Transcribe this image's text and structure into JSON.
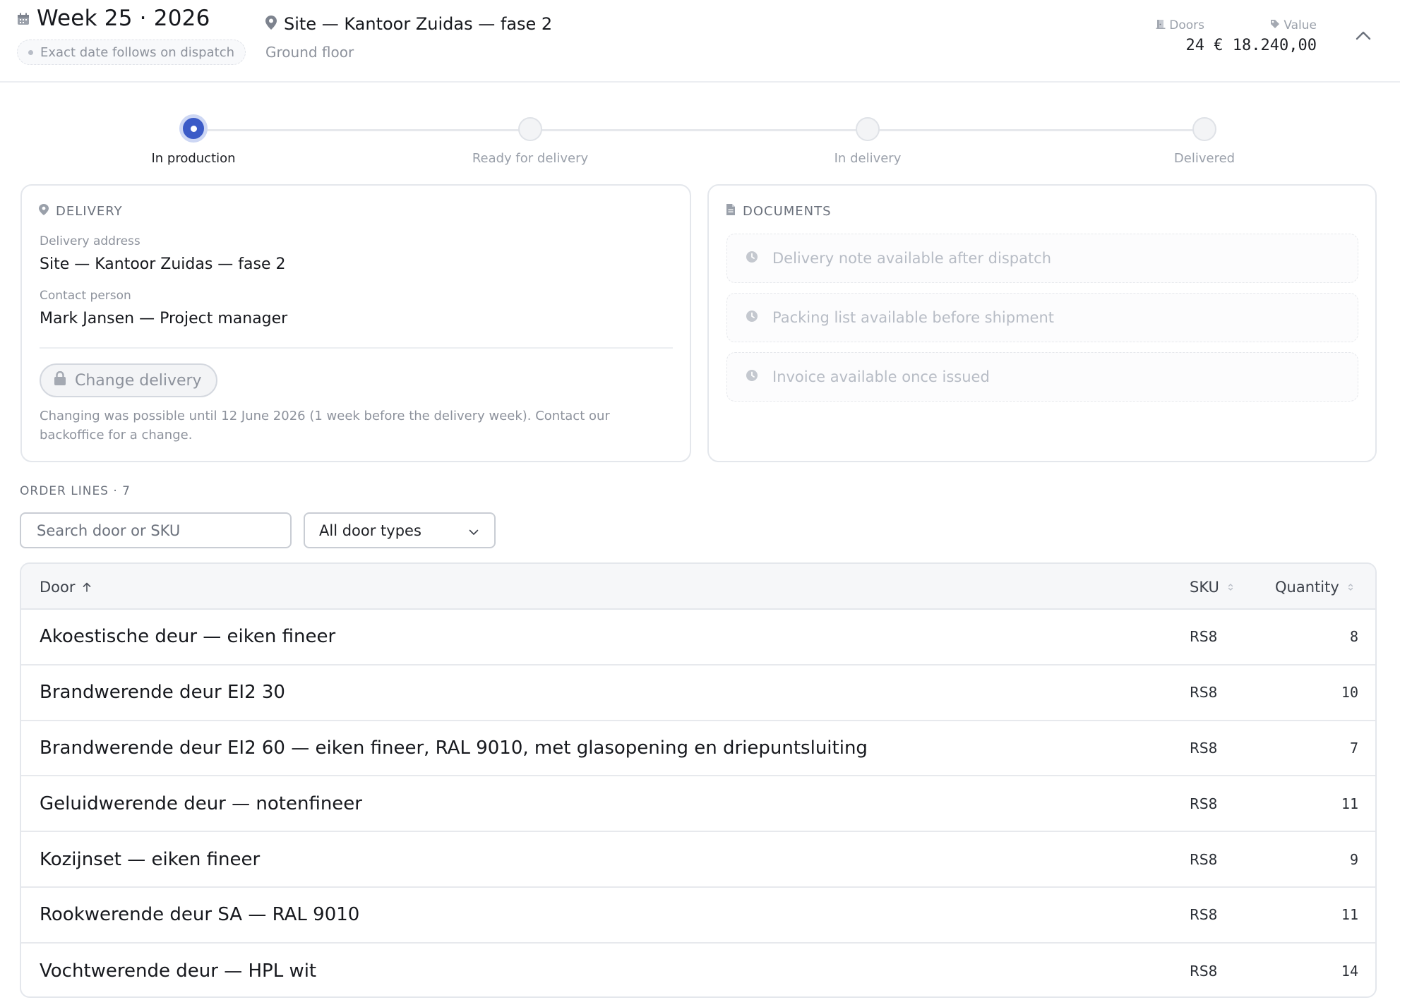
{
  "header": {
    "week_title": "Week 25 · 2026",
    "exact_date_note": "Exact date follows on dispatch",
    "site_title": "Site — Kantoor Zuidas — fase 2",
    "site_subtitle": "Ground floor",
    "stats": {
      "doors_label": "Doors",
      "doors_value": "24",
      "value_label": "Value",
      "value_value": "€ 18.240,00"
    },
    "icons": {
      "calendar": "calendar-icon",
      "location": "map-pin-icon",
      "doors": "door-icon",
      "value": "price-tag-icon",
      "collapse": "chevron-up-icon"
    }
  },
  "stepper": {
    "active_index": 0,
    "steps": [
      {
        "label": "In production"
      },
      {
        "label": "Ready for delivery"
      },
      {
        "label": "In delivery"
      },
      {
        "label": "Delivered"
      }
    ],
    "active_color": "#3b5bc7"
  },
  "delivery": {
    "heading": "DELIVERY",
    "address_label": "Delivery address",
    "address_value": "Site — Kantoor Zuidas — fase 2",
    "contact_label": "Contact person",
    "contact_value": "Mark Jansen — Project manager",
    "change_button": "Change delivery",
    "change_note": "Changing was possible until 12 June 2026 (1 week before the delivery week). Contact our backoffice for a change."
  },
  "documents": {
    "heading": "DOCUMENTS",
    "items": [
      {
        "label": "Delivery note available after dispatch",
        "icon": "clock-icon"
      },
      {
        "label": "Packing list available before shipment",
        "icon": "clock-icon"
      },
      {
        "label": "Invoice available once issued",
        "icon": "clock-icon"
      }
    ]
  },
  "order_lines": {
    "title": "ORDER LINES · 7",
    "search_placeholder": "Search door or SKU",
    "filter_selected": "All door types",
    "columns": {
      "door": "Door",
      "sku": "SKU",
      "quantity": "Quantity"
    },
    "rows": [
      {
        "door": "Akoestische deur — eiken fineer",
        "sku": "RS8",
        "quantity": "8"
      },
      {
        "door": "Brandwerende deur EI2 30",
        "sku": "RS8",
        "quantity": "10"
      },
      {
        "door": "Brandwerende deur EI2 60 — eiken fineer, RAL 9010, met glasopening en driepuntsluiting",
        "sku": "RS8",
        "quantity": "7"
      },
      {
        "door": "Geluidwerende deur — notenfineer",
        "sku": "RS8",
        "quantity": "11"
      },
      {
        "door": "Kozijnset — eiken fineer",
        "sku": "RS8",
        "quantity": "9"
      },
      {
        "door": "Rookwerende deur SA — RAL 9010",
        "sku": "RS8",
        "quantity": "11"
      },
      {
        "door": "Vochtwerende deur — HPL wit",
        "sku": "RS8",
        "quantity": "14"
      }
    ]
  }
}
